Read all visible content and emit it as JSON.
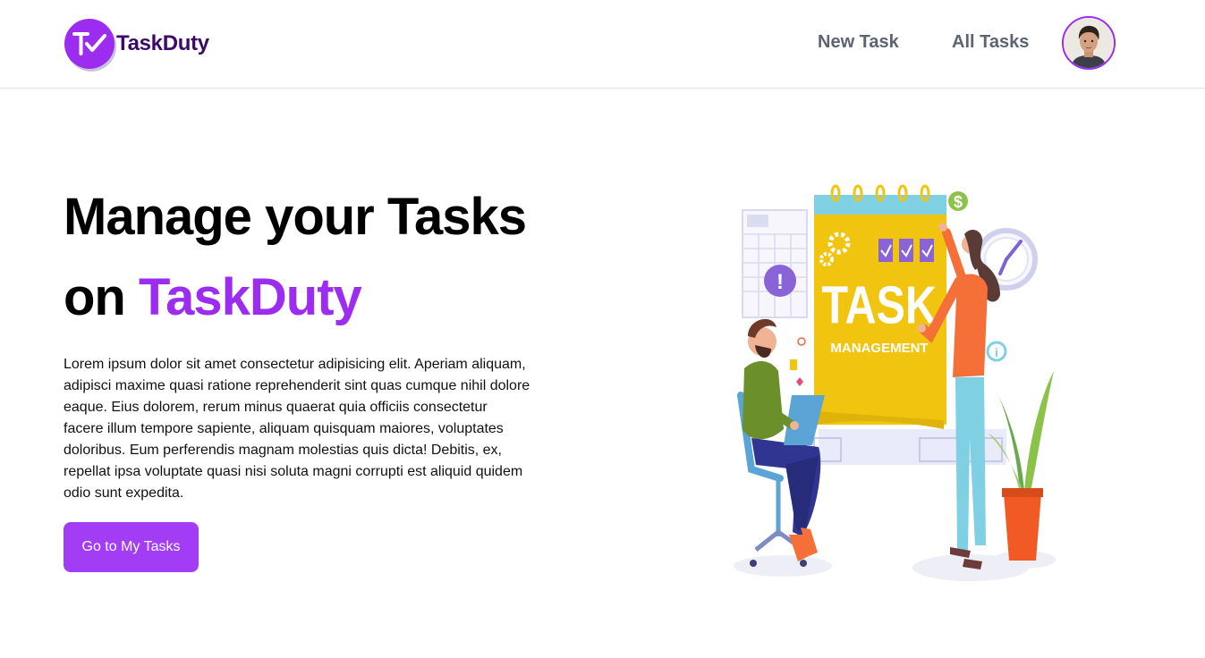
{
  "header": {
    "logo_text": "TaskDuty",
    "nav": {
      "new_task": "New Task",
      "all_tasks": "All Tasks"
    }
  },
  "hero": {
    "title_line1": "Manage your Tasks",
    "title_line2_prefix": "on",
    "title_brand": "TaskDuty",
    "description": "Lorem ipsum dolor sit amet consectetur adipisicing elit. Aperiam aliquam, adipisci maxime quasi ratione reprehenderit sint quas cumque nihil dolore eaque. Eius dolorem, rerum minus quaerat quia officiis consectetur facere illum tempore sapiente, aliquam quisquam maiores, voluptates doloribus. Eum perferendis magnam molestias quis dicta! Debitis, ex, repellat ipsa voluptate quasi nisi soluta magni corrupti est aliquid quidem odio sunt expedita.",
    "cta_label": "Go to My Tasks"
  },
  "illustration": {
    "board_title": "TASK",
    "board_subtitle": "MANAGEMENT",
    "currency_symbol": "$",
    "alert_symbol": "!",
    "info_symbol": "i"
  },
  "colors": {
    "brand": "#9b2cf0",
    "logo_text": "#3b0a6b",
    "nav_text": "#5b6470",
    "cta": "#a33cf5"
  },
  "icons": {
    "logo": "tv-check-logo-icon",
    "avatar": "user-avatar"
  }
}
